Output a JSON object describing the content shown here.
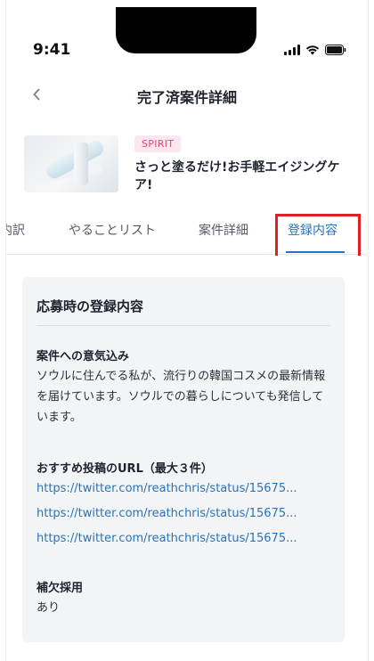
{
  "status_bar": {
    "time": "9:41"
  },
  "header": {
    "title": "完了済案件詳細"
  },
  "campaign": {
    "brand": "SPIRIT",
    "title": "さっと塗るだけ!お手軽エイジングケア!"
  },
  "tabs": [
    {
      "label": "内訳"
    },
    {
      "label": "やることリスト"
    },
    {
      "label": "案件詳細"
    },
    {
      "label": "登録内容",
      "active": true
    }
  ],
  "registration": {
    "heading": "応募時の登録内容",
    "motivation_label": "案件への意気込み",
    "motivation_text": "ソウルに住んでる私が、流行りの韓国コスメの最新情報を届けています。ソウルでの暮らしについても発信しています。",
    "urls_label": "おすすめ投稿のURL（最大３件）",
    "urls": [
      "https://twitter.com/reathchris/status/15675...",
      "https://twitter.com/reathchris/status/15675...",
      "https://twitter.com/reathchris/status/15675..."
    ],
    "backup_label": "補欠採用",
    "backup_value": "あり"
  },
  "colors": {
    "accent": "#2a73b8",
    "badge_bg": "#fde6ef",
    "badge_text": "#e0497a",
    "highlight": "#e02020"
  }
}
